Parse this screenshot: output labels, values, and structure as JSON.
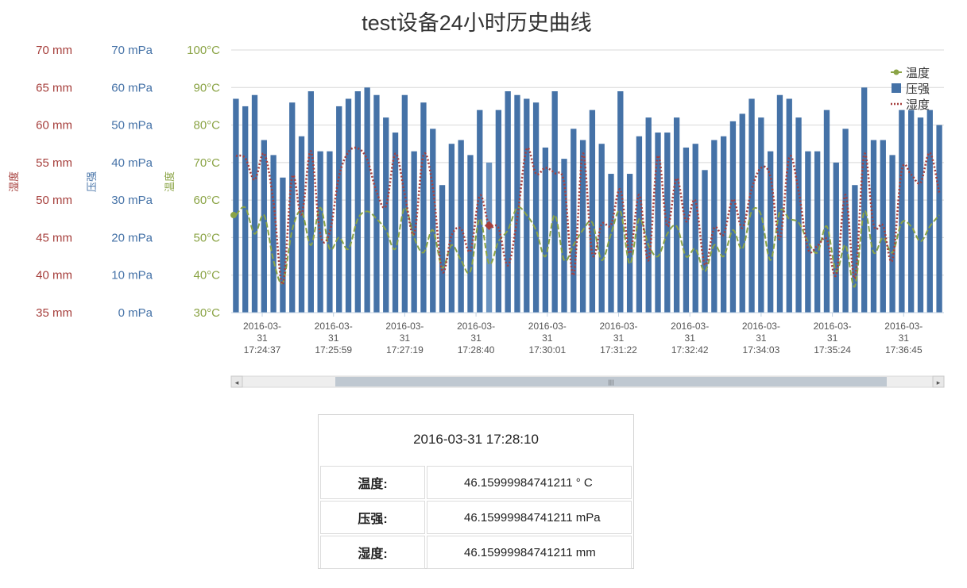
{
  "page": {
    "title": "test设备24小时历史曲线"
  },
  "colors": {
    "temp": "#8ba446",
    "pressure": "#4572a7",
    "pressure_highlight": "#6a93c0",
    "humidity": "#a63f3c",
    "grid": "#d8d8d8",
    "axis": "#c0d0e0",
    "scroll_track": "#eeeeee",
    "scroll_thumb": "#bfc8d1"
  },
  "axes": {
    "temperature": {
      "name": "温度",
      "ticks": [
        "30°C",
        "40°C",
        "50°C",
        "60°C",
        "70°C",
        "80°C",
        "90°C",
        "100°C"
      ]
    },
    "pressure": {
      "name": "压强",
      "ticks": [
        "0 mPa",
        "10 mPa",
        "20 mPa",
        "30 mPa",
        "40 mPa",
        "50 mPa",
        "60 mPa",
        "70 mPa"
      ]
    },
    "humidity": {
      "name": "湿度",
      "ticks": [
        "35 mm",
        "40 mm",
        "45 mm",
        "50 mm",
        "55 mm",
        "60 mm",
        "65 mm",
        "70 mm"
      ]
    }
  },
  "legend": [
    {
      "name": "温度",
      "symbol": "line-dot"
    },
    {
      "name": "压强",
      "symbol": "square"
    },
    {
      "name": "湿度",
      "symbol": "dotted"
    }
  ],
  "scrollbar": {
    "grip": "|||",
    "left_arrow": "◂",
    "right_arrow": "▸"
  },
  "tooltip": {
    "time": "2016-03-31 17:28:10",
    "rows": [
      {
        "label": "温度:",
        "value": "46.15999984741211 ° C"
      },
      {
        "label": "压强:",
        "value": "46.15999984741211 mPa"
      },
      {
        "label": "湿度:",
        "value": "46.15999984741211 mm"
      }
    ]
  },
  "chart_data": {
    "type": "bar",
    "title": "test设备24小时历史曲线",
    "legend_position": "top-right",
    "grid": true,
    "x_tick_labels": [
      [
        "2016-03-",
        "31",
        "17:24:37"
      ],
      [
        "2016-03-",
        "31",
        "17:25:59"
      ],
      [
        "2016-03-",
        "31",
        "17:27:19"
      ],
      [
        "2016-03-",
        "31",
        "17:28:40"
      ],
      [
        "2016-03-",
        "31",
        "17:30:01"
      ],
      [
        "2016-03-",
        "31",
        "17:31:22"
      ],
      [
        "2016-03-",
        "31",
        "17:32:42"
      ],
      [
        "2016-03-",
        "31",
        "17:34:03"
      ],
      [
        "2016-03-",
        "31",
        "17:35:24"
      ],
      [
        "2016-03-",
        "31",
        "17:36:45"
      ]
    ],
    "highlight_index": 27,
    "series": [
      {
        "name": "压强",
        "type": "column",
        "axis": "pressure",
        "ylim": [
          0,
          70
        ],
        "values": [
          57,
          55,
          58,
          46,
          42,
          36,
          56,
          47,
          59,
          43,
          43,
          55,
          57,
          59,
          60,
          58,
          52,
          48,
          58,
          43,
          56,
          49,
          34,
          45,
          46,
          42,
          54,
          40,
          54,
          59,
          58,
          57,
          56,
          44,
          59,
          41,
          49,
          46,
          54,
          45,
          37,
          59,
          37,
          47,
          52,
          48,
          48,
          52,
          44,
          45,
          38,
          46,
          47,
          51,
          53,
          57,
          52,
          43,
          58,
          57,
          52,
          43,
          43,
          54,
          40,
          49,
          34,
          60,
          46,
          46,
          42,
          54,
          54,
          52,
          54,
          50
        ]
      },
      {
        "name": "温度",
        "type": "line",
        "axis": "temperature",
        "ylim": [
          30,
          100
        ],
        "values": [
          56,
          58,
          51,
          56,
          44,
          38,
          52,
          57,
          48,
          58,
          47,
          50,
          47,
          55,
          57,
          55,
          52,
          47,
          58,
          50,
          46,
          52,
          42,
          48,
          44,
          41,
          55,
          43,
          49,
          52,
          58,
          56,
          52,
          45,
          56,
          44,
          48,
          52,
          54,
          44,
          51,
          57,
          43,
          55,
          48,
          45,
          51,
          53,
          45,
          47,
          41,
          48,
          45,
          52,
          47,
          57,
          56,
          44,
          57,
          55,
          54,
          49,
          46,
          53,
          41,
          48,
          37,
          57,
          46,
          50,
          46,
          54,
          53,
          49,
          53,
          56
        ]
      },
      {
        "name": "湿度",
        "type": "spline",
        "axis": "humidity",
        "ylim": [
          35,
          70
        ],
        "marker_index": 27,
        "values": [
          55.9,
          55.6,
          52.7,
          56.2,
          49.8,
          38.8,
          53.1,
          48.1,
          56.5,
          45.4,
          45.7,
          53.2,
          56.4,
          56.9,
          55.4,
          51.1,
          49.2,
          56.2,
          50.8,
          45.5,
          56.0,
          51.7,
          40.5,
          45.3,
          46.2,
          43.2,
          50.6,
          46.6,
          46.3,
          41.3,
          47.6,
          56.8,
          53.5,
          54.3,
          53.6,
          52.3,
          40.0,
          56.2,
          42.8,
          46.8,
          46.7,
          51.4,
          42.9,
          50.7,
          42.0,
          55.9,
          46.5,
          52.9,
          47.2,
          49.9,
          41.4,
          46.3,
          45.4,
          50.1,
          46.3,
          51.5,
          54.3,
          53.1,
          44.8,
          55.7,
          51.2,
          43.5,
          43.9,
          44.8,
          40.0,
          50.7,
          39.6,
          56.1,
          46.7,
          46.6,
          42.0,
          54.0,
          53.4,
          52.3,
          56.3,
          51.0
        ]
      }
    ]
  }
}
